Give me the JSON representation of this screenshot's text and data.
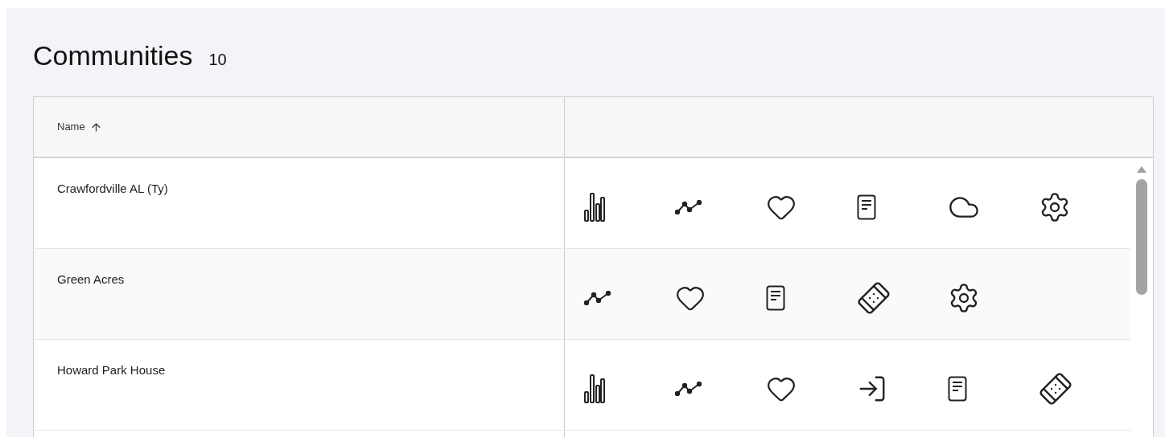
{
  "header": {
    "title": "Communities",
    "count": "10"
  },
  "table": {
    "columns": [
      {
        "label": "Name",
        "sorted_ascending": true
      }
    ],
    "rows": [
      {
        "name": "Crawfordville AL (Ty)",
        "actions": [
          {
            "kind": "bars"
          },
          {
            "kind": "trend"
          },
          {
            "kind": "heart"
          },
          {
            "kind": "document"
          },
          {
            "kind": "cloud"
          },
          {
            "kind": "gear"
          }
        ]
      },
      {
        "name": "Green Acres",
        "actions": [
          {
            "kind": "trend"
          },
          {
            "kind": "heart"
          },
          {
            "kind": "document"
          },
          {
            "kind": "bandage"
          },
          {
            "kind": "gear"
          }
        ]
      },
      {
        "name": "Howard Park House",
        "actions": [
          {
            "kind": "bars"
          },
          {
            "kind": "trend"
          },
          {
            "kind": "heart"
          },
          {
            "kind": "login"
          },
          {
            "kind": "document"
          },
          {
            "kind": "bandage"
          }
        ]
      }
    ]
  }
}
